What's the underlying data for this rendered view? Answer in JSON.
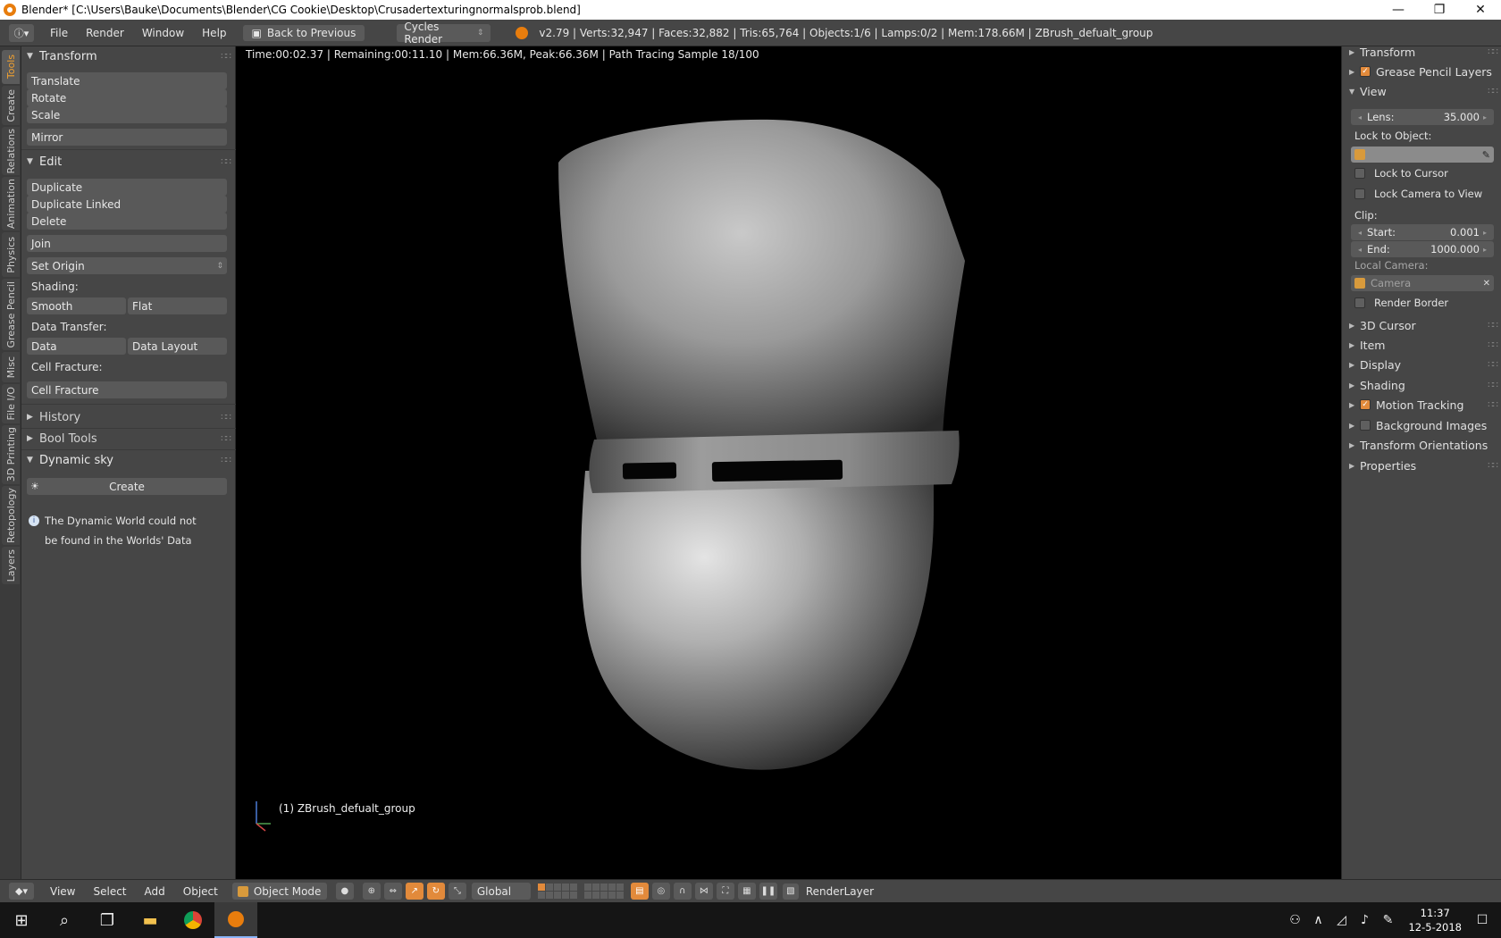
{
  "window": {
    "title": "Blender* [C:\\Users\\Bauke\\Documents\\Blender\\CG Cookie\\Desktop\\Crusadertexturingnormalsprob.blend]",
    "minimize": "—",
    "maximize": "❐",
    "close": "✕"
  },
  "info_header": {
    "menus": [
      "File",
      "Render",
      "Window",
      "Help"
    ],
    "back_label": "Back to Previous",
    "render_engine": "Cycles Render",
    "stats": "v2.79 | Verts:32,947 | Faces:32,882 | Tris:65,764 | Objects:1/6 | Lamps:0/2 | Mem:178.66M | ZBrush_defualt_group"
  },
  "tabs": [
    "Tools",
    "Create",
    "Relations",
    "Animation",
    "Physics",
    "Grease Pencil",
    "Misc",
    "File I/O",
    "3D Printing",
    "Retopology",
    "Layers"
  ],
  "toolshelf": {
    "transform": {
      "title": "Transform",
      "translate": "Translate",
      "rotate": "Rotate",
      "scale": "Scale",
      "mirror": "Mirror"
    },
    "edit": {
      "title": "Edit",
      "duplicate": "Duplicate",
      "duplicate_linked": "Duplicate Linked",
      "delete": "Delete",
      "join": "Join",
      "set_origin": "Set Origin",
      "shading_label": "Shading:",
      "smooth": "Smooth",
      "flat": "Flat",
      "data_transfer_label": "Data Transfer:",
      "data": "Data",
      "data_layout": "Data Layout",
      "cell_fracture_label": "Cell Fracture:",
      "cell_fracture": "Cell Fracture"
    },
    "history": "History",
    "bool_tools": "Bool Tools",
    "dynamic_sky": {
      "title": "Dynamic sky",
      "create": "Create",
      "message_line1": "The Dynamic World could not",
      "message_line2": "be found in the Worlds' Data"
    }
  },
  "viewport": {
    "render_status": "Time:00:02.37 | Remaining:00:11.10 | Mem:66.36M, Peak:66.36M | Path Tracing Sample 18/100",
    "object_name": "(1) ZBrush_defualt_group"
  },
  "properties": {
    "transform": "Transform",
    "grease_pencil_layers": "Grease Pencil Layers",
    "view": {
      "title": "View",
      "lens_label": "Lens:",
      "lens_value": "35.000",
      "lock_to_object": "Lock to Object:",
      "lock_to_cursor": "Lock to Cursor",
      "lock_camera_to_view": "Lock Camera to View",
      "clip_label": "Clip:",
      "start_label": "Start:",
      "start_value": "0.001",
      "end_label": "End:",
      "end_value": "1000.000",
      "local_camera_label": "Local Camera:",
      "camera": "Camera",
      "render_border": "Render Border"
    },
    "collapsed": [
      "3D Cursor",
      "Item",
      "Display",
      "Shading"
    ],
    "motion_tracking": "Motion Tracking",
    "background_images": "Background Images",
    "transform_orientations": "Transform Orientations",
    "properties": "Properties"
  },
  "view3d_header": {
    "menus": [
      "View",
      "Select",
      "Add",
      "Object"
    ],
    "mode": "Object Mode",
    "orientation": "Global",
    "render_layer": "RenderLayer"
  },
  "taskbar": {
    "time": "11:37",
    "date": "12-5-2018"
  },
  "colors": {
    "accent": "#e28a3b",
    "panel": "#464646",
    "button": "#595959"
  }
}
